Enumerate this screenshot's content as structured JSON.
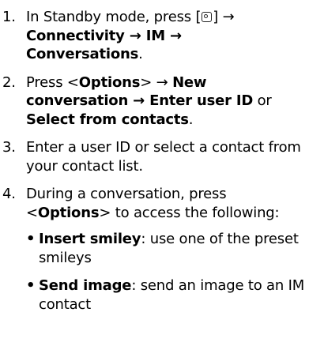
{
  "steps": [
    {
      "num": "1.",
      "a": "In Standby mode, press [",
      "icon": "menu-key-icon",
      "b": "] →",
      "c": "Connectivity → IM →",
      "d": "Conversations",
      "e": "."
    },
    {
      "num": "2.",
      "a": "Press <",
      "b": "Options",
      "c": "> → ",
      "d": "New",
      "e": "conversation → Enter user ID",
      "f": " or",
      "g": "Select from contacts",
      "h": "."
    },
    {
      "num": "3.",
      "text": "Enter a user ID or select a contact from your contact list."
    },
    {
      "num": "4.",
      "a": "During a conversation, press",
      "b": "<",
      "c": "Options",
      "d": "> to access the following:",
      "bullets": [
        {
          "marker": "•",
          "term": "Insert smiley",
          "desc": ": use one of the preset smileys"
        },
        {
          "marker": "•",
          "term": "Send image",
          "desc": ": send an image to an IM contact"
        }
      ]
    }
  ]
}
